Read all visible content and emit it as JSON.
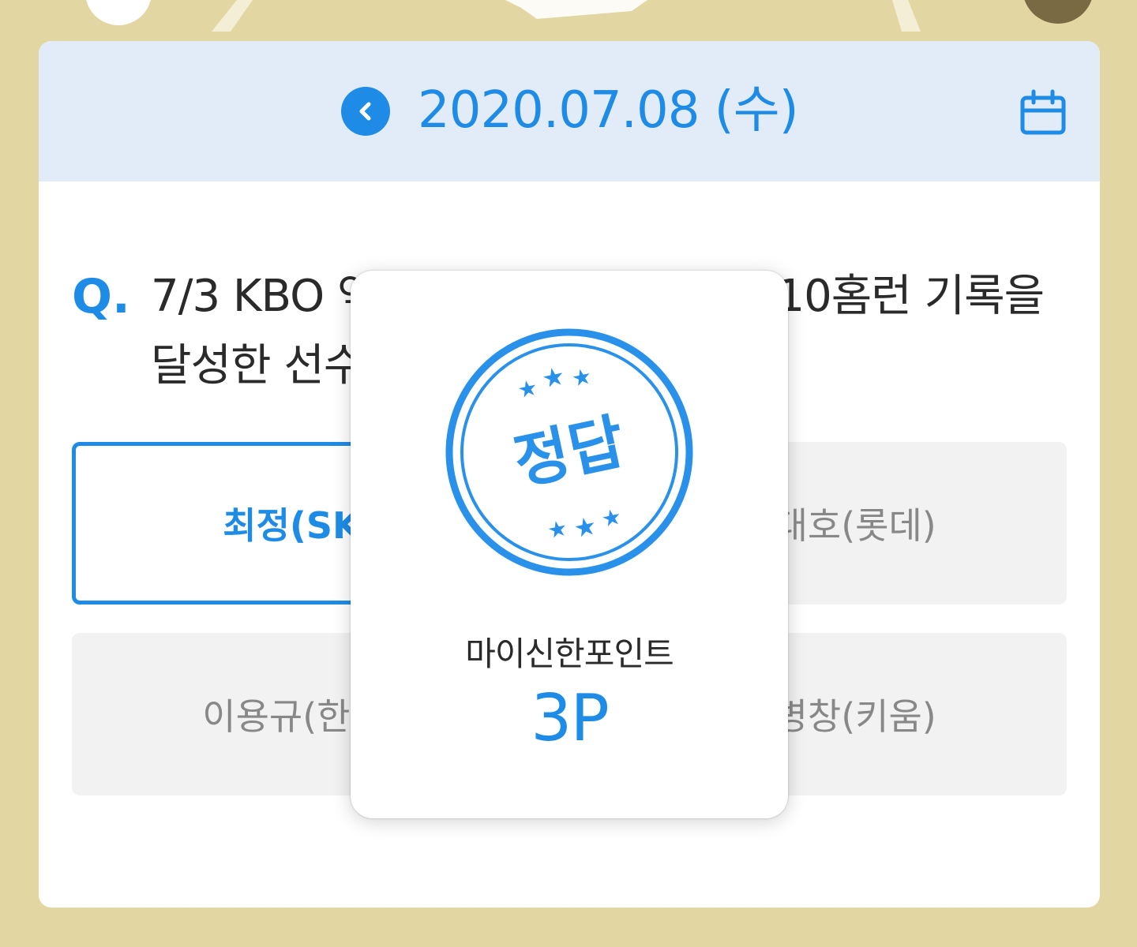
{
  "header": {
    "date": "2020.07.08 (수)",
    "prev_icon": "chevron-left-icon",
    "calendar_icon": "calendar-icon"
  },
  "question": {
    "marker": "Q.",
    "text": "7/3 KBO 역대 세번째 4타석 연속 10홈런 기록을 달성한 선수는?"
  },
  "options": [
    {
      "label": "최정(SK)",
      "selected": true
    },
    {
      "label": "이대호(롯데)",
      "selected": false
    },
    {
      "label": "이용규(한화)",
      "selected": false
    },
    {
      "label": "박병창(키움)",
      "selected": false
    }
  ],
  "popup": {
    "stamp_text": "정답",
    "reward_label": "마이신한포인트",
    "reward_value": "3P"
  },
  "colors": {
    "accent": "#1e8ce6",
    "background": "#e2d6a2",
    "header_bg": "#e1ecf8"
  }
}
